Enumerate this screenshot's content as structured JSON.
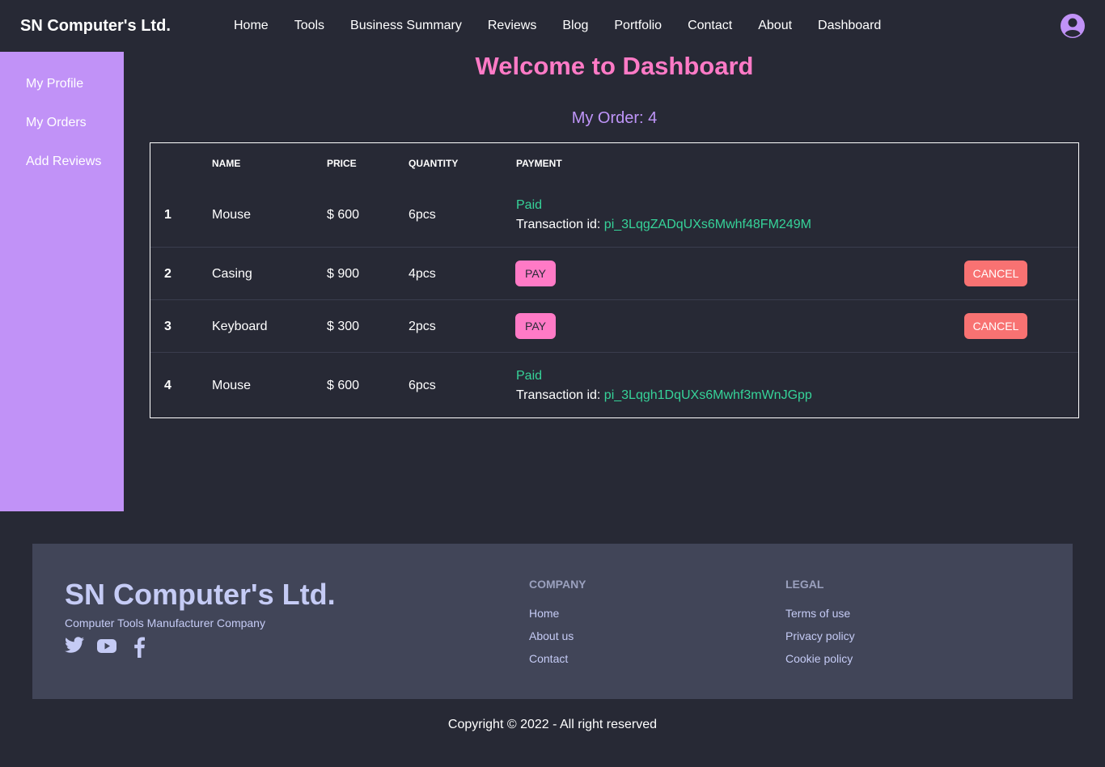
{
  "navbar": {
    "brand": "SN Computer's Ltd.",
    "links": [
      "Home",
      "Tools",
      "Business Summary",
      "Reviews",
      "Blog",
      "Portfolio",
      "Contact",
      "About",
      "Dashboard"
    ],
    "avatar_icon": "user-circle-icon"
  },
  "sidebar": {
    "items": [
      "My Profile",
      "My Orders",
      "Add Reviews"
    ]
  },
  "main": {
    "title": "Welcome to Dashboard",
    "order_count": "My Order: 4"
  },
  "table": {
    "headers": [
      "Name",
      "Price",
      "Quantity",
      "Payment"
    ],
    "rows": [
      {
        "index": "1",
        "name": "Mouse",
        "price": "$ 600",
        "quantity": "6pcs",
        "paid": "Paid",
        "txn_label": "Transaction id:",
        "txn_id": "pi_3LqgZADqUXs6Mwhf48FM249M"
      },
      {
        "index": "2",
        "name": "Casing",
        "price": "$ 900",
        "quantity": "4pcs",
        "pay": "PAY",
        "cancel": "CANCEL"
      },
      {
        "index": "3",
        "name": "Keyboard",
        "price": "$ 300",
        "quantity": "2pcs",
        "pay": "PAY",
        "cancel": "CANCEL"
      },
      {
        "index": "4",
        "name": "Mouse",
        "price": "$ 600",
        "quantity": "6pcs",
        "paid": "Paid",
        "txn_label": "Transaction id:",
        "txn_id": "pi_3Lqgh1DqUXs6Mwhf3mWnJGpp"
      }
    ]
  },
  "footer": {
    "brand": "SN Computer's Ltd.",
    "tagline": "Computer Tools Manufacturer Company",
    "social_icons": [
      "twitter-icon",
      "youtube-icon",
      "facebook-icon"
    ],
    "company": {
      "title": "Company",
      "links": [
        "Home",
        "About us",
        "Contact"
      ]
    },
    "legal": {
      "title": "Legal",
      "links": [
        "Terms of use",
        "Privacy policy",
        "Cookie policy"
      ]
    },
    "copyright": "Copyright © 2022 - All right reserved"
  },
  "colors": {
    "background": "#272935",
    "sidebar": "#c192f7",
    "title_pink": "#ff7ac6",
    "order_purple": "#bf95f9",
    "paid_green": "#36d399",
    "cancel_red": "#f87272",
    "footer_bg": "#414558",
    "footer_text": "#c5cbf5"
  }
}
